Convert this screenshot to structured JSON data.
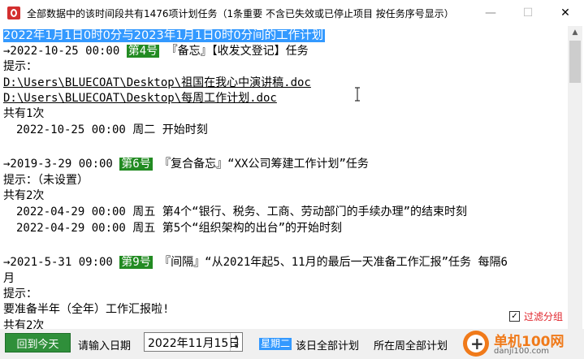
{
  "window": {
    "title": "全部数据中的该时间段共有1476项计划任务（1条重要 不含已失效或已停止项目 按任务序号显示）",
    "minimize": "—",
    "maximize": "☐",
    "close": "✕"
  },
  "content": {
    "header": "2022年1月1日0时0分与2023年1月1日0时0分间的工作计划",
    "tasks": [
      {
        "arrow": "→2022-10-25 00:00 ",
        "num": "第4号",
        "desc": " 『备忘』【收发文登记】任务",
        "hint_label": "提示：",
        "links": [
          "D:\\Users\\BLUECOAT\\Desktop\\祖国在我心中演讲稿.doc",
          "D:\\Users\\BLUECOAT\\Desktop\\每周工作计划.doc"
        ],
        "count": "共有1次",
        "times": [
          "2022-10-25 00:00 周二 开始时刻"
        ]
      },
      {
        "arrow": "→2019-3-29 00:00 ",
        "num": "第6号",
        "desc": " 『复合备忘』“XX公司筹建工作计划”任务",
        "hint": "提示：（未设置）",
        "count": "共有2次",
        "times": [
          "2022-04-29 00:00 周五 第4个“银行、税务、工商、劳动部门的手续办理”的结束时刻",
          "2022-04-29 00:00 周五 第5个“组织架构的出台”的开始时刻"
        ]
      },
      {
        "arrow": "→2021-5-31 09:00 ",
        "num": "第9号",
        "desc": " 『间隔』“从2021年起5、11月的最后一天准备工作汇报”任务 每隔6",
        "desc_cont": "月",
        "hint_label": "提示：",
        "hint_text": "要准备半年（全年）工作汇报啦!",
        "count": "共有2次"
      }
    ]
  },
  "filter": {
    "label": "过滤分组",
    "checked": "✓"
  },
  "bottom": {
    "today_button": "回到今天",
    "date_label": "请输入日期",
    "date_value": "2022年11月15日",
    "weekday": "星期二",
    "day_all": "该日全部计划",
    "week_all": "所在周全部计划"
  },
  "watermark": {
    "title": "单机100网",
    "sub": "danji100.com"
  }
}
